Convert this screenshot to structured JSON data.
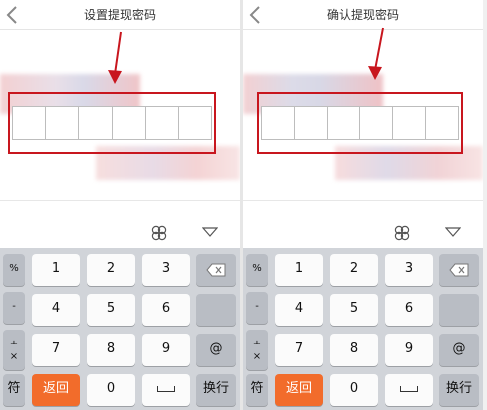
{
  "left": {
    "title": "设置提现密码",
    "keys": {
      "row1": [
        "%",
        "1",
        "2",
        "3"
      ],
      "row2": [
        "-",
        "4",
        "5",
        "6"
      ],
      "row3": [
        "+",
        "7",
        "8",
        "9",
        "@"
      ],
      "row4_side": "×",
      "bottom": {
        "symbol": "符",
        "return": "返回",
        "zero": "0",
        "enter": "换行"
      }
    }
  },
  "right": {
    "title": "确认提现密码",
    "keys": {
      "row1": [
        "%",
        "1",
        "2",
        "3"
      ],
      "row2": [
        "-",
        "4",
        "5",
        "6"
      ],
      "row3": [
        "+",
        "7",
        "8",
        "9",
        "@"
      ],
      "row4_side": "×",
      "bottom": {
        "symbol": "符",
        "return": "返回",
        "zero": "0",
        "enter": "换行"
      }
    }
  },
  "icons": {
    "back": "chevron-left-icon",
    "clover": "clover-icon",
    "collapse": "triangle-down-icon",
    "delete": "backspace-icon"
  },
  "colors": {
    "annotation_red": "#c8161e",
    "return_key": "#f26c2b",
    "keyboard_bg": "#d1d4d9"
  }
}
